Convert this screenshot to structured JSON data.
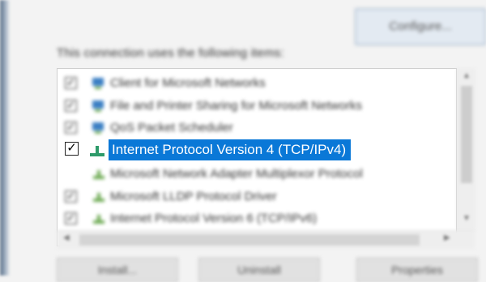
{
  "dialog": {
    "configure_button": "Configure...",
    "uses_label": "This connection uses the following items:",
    "selected_color": "#0a78d7"
  },
  "items": [
    {
      "label": "Client for Microsoft Networks",
      "checked": true,
      "icon": "network-client-icon"
    },
    {
      "label": "File and Printer Sharing for Microsoft Networks",
      "checked": true,
      "icon": "network-share-icon"
    },
    {
      "label": "QoS Packet Scheduler",
      "checked": true,
      "icon": "network-service-icon"
    },
    {
      "label": "Internet Protocol Version 4 (TCP/IPv4)",
      "checked": true,
      "icon": "network-protocol-icon",
      "selected": true
    },
    {
      "label": "Microsoft Network Adapter Multiplexor Protocol",
      "checked": false,
      "icon": "network-protocol-icon"
    },
    {
      "label": "Microsoft LLDP Protocol Driver",
      "checked": true,
      "icon": "network-protocol-icon"
    },
    {
      "label": "Internet Protocol Version 6 (TCP/IPv6)",
      "checked": true,
      "icon": "network-protocol-icon"
    }
  ],
  "buttons": {
    "install": "Install...",
    "uninstall": "Uninstall",
    "properties": "Properties"
  }
}
